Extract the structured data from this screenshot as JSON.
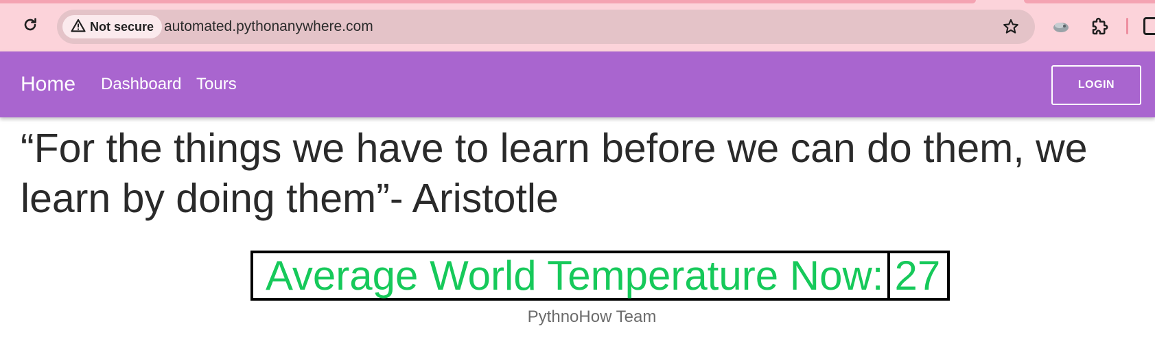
{
  "browser": {
    "security_label": "Not secure",
    "url": "automated.pythonanywhere.com",
    "colors": {
      "chrome_bg": "#fcd3da",
      "omnibox_bg": "#e4c3c8"
    }
  },
  "navbar": {
    "brand": "Home",
    "links": [
      "Dashboard",
      "Tours"
    ],
    "login_label": "LOGIN",
    "color": "#a965cf"
  },
  "content": {
    "quote": "“For the things we have to learn before we can do them, we learn by doing them”- Aristotle",
    "temperature_label": "Average World Temperature Now:",
    "temperature_value": "27",
    "team": "PythnoHow Team",
    "accent_color": "#16c95a"
  },
  "icons": [
    "reload-icon",
    "warning-icon",
    "star-icon",
    "extension-blob-icon",
    "puzzle-icon",
    "side-panel-icon"
  ]
}
